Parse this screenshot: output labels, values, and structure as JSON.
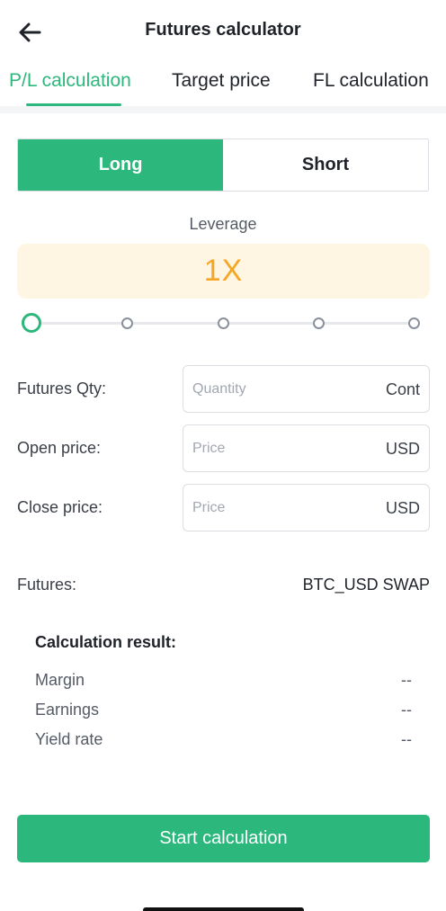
{
  "header": {
    "title": "Futures calculator",
    "back_icon": "back-arrow-icon"
  },
  "tabs": [
    {
      "label": "P/L calculation",
      "active": true
    },
    {
      "label": "Target price",
      "active": false
    },
    {
      "label": "FL calculation",
      "active": false
    }
  ],
  "direction": {
    "options": [
      {
        "label": "Long",
        "active": true
      },
      {
        "label": "Short",
        "active": false
      }
    ]
  },
  "leverage": {
    "label": "Leverage",
    "value": "1X",
    "slider_stops": 5,
    "selected_stop": 0
  },
  "fields": [
    {
      "label": "Futures Qty:",
      "placeholder": "Quantity",
      "value": "",
      "unit": "Cont"
    },
    {
      "label": "Open price:",
      "placeholder": "Price",
      "value": "",
      "unit": "USD"
    },
    {
      "label": "Close price:",
      "placeholder": "Price",
      "value": "",
      "unit": "USD"
    }
  ],
  "futures": {
    "label": "Futures:",
    "value": "BTC_USD SWAP"
  },
  "result": {
    "title": "Calculation result:",
    "rows": [
      {
        "label": "Margin",
        "value": "--"
      },
      {
        "label": "Earnings",
        "value": "--"
      },
      {
        "label": "Yield rate",
        "value": "--"
      }
    ]
  },
  "actions": {
    "start_label": "Start calculation"
  },
  "colors": {
    "accent": "#2cb87c",
    "leverage_text": "#f5a623",
    "leverage_bg": "#fff5e3"
  }
}
